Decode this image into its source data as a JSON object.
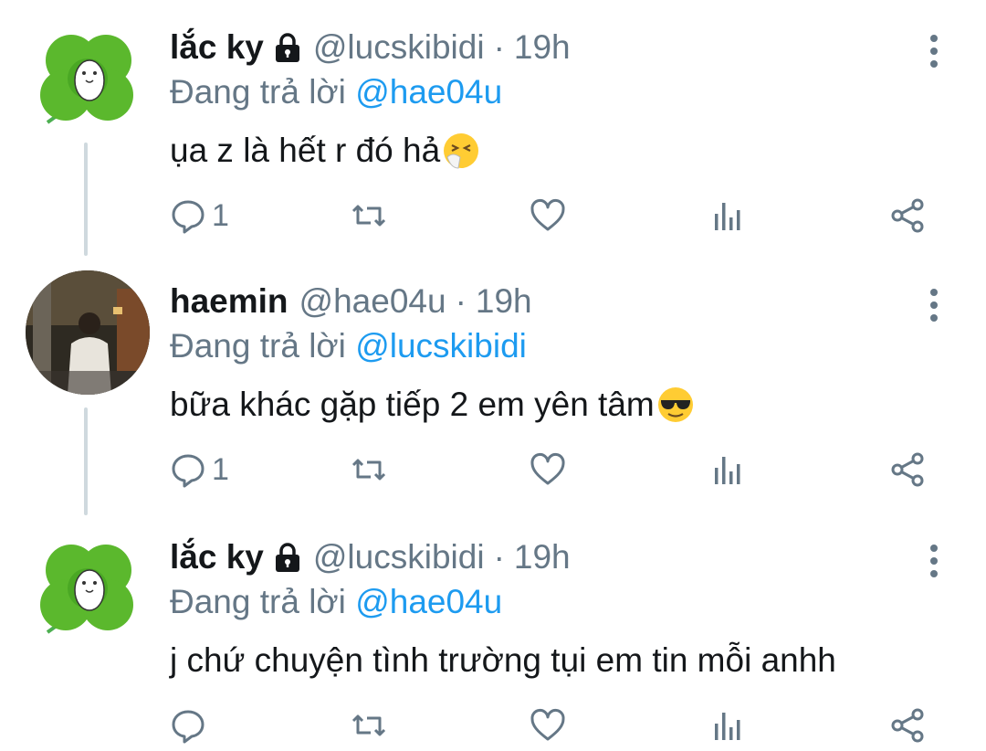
{
  "colors": {
    "accent": "#1d9bf0",
    "secondary_text": "#657786",
    "thread_line": "#cfd9de"
  },
  "tweets": [
    {
      "name": "lắc ky",
      "protected": true,
      "handle": "@lucskibidi",
      "separator": "·",
      "time": "19h",
      "replying_prefix": "Đang trả lời",
      "replying_to": "@hae04u",
      "text": "ụa z là hết r đó hả",
      "emoji": "sneezing-face",
      "reply_count": "1",
      "avatar": "clover-avatar"
    },
    {
      "name": "haemin",
      "protected": false,
      "handle": "@hae04u",
      "separator": "·",
      "time": "19h",
      "replying_prefix": "Đang trả lời",
      "replying_to": "@lucskibidi",
      "text": "bữa khác gặp tiếp 2 em yên tâm",
      "emoji": "sunglasses-face",
      "reply_count": "1",
      "avatar": "photo-avatar"
    },
    {
      "name": "lắc ky",
      "protected": true,
      "handle": "@lucskibidi",
      "separator": "·",
      "time": "19h",
      "replying_prefix": "Đang trả lời",
      "replying_to": "@hae04u",
      "text": "j chứ chuyện tình trường tụi em tin mỗi anhh",
      "emoji": "",
      "reply_count": "",
      "avatar": "clover-avatar"
    }
  ],
  "action_icons": [
    "reply-icon",
    "retweet-icon",
    "like-icon",
    "analytics-icon",
    "share-icon"
  ]
}
